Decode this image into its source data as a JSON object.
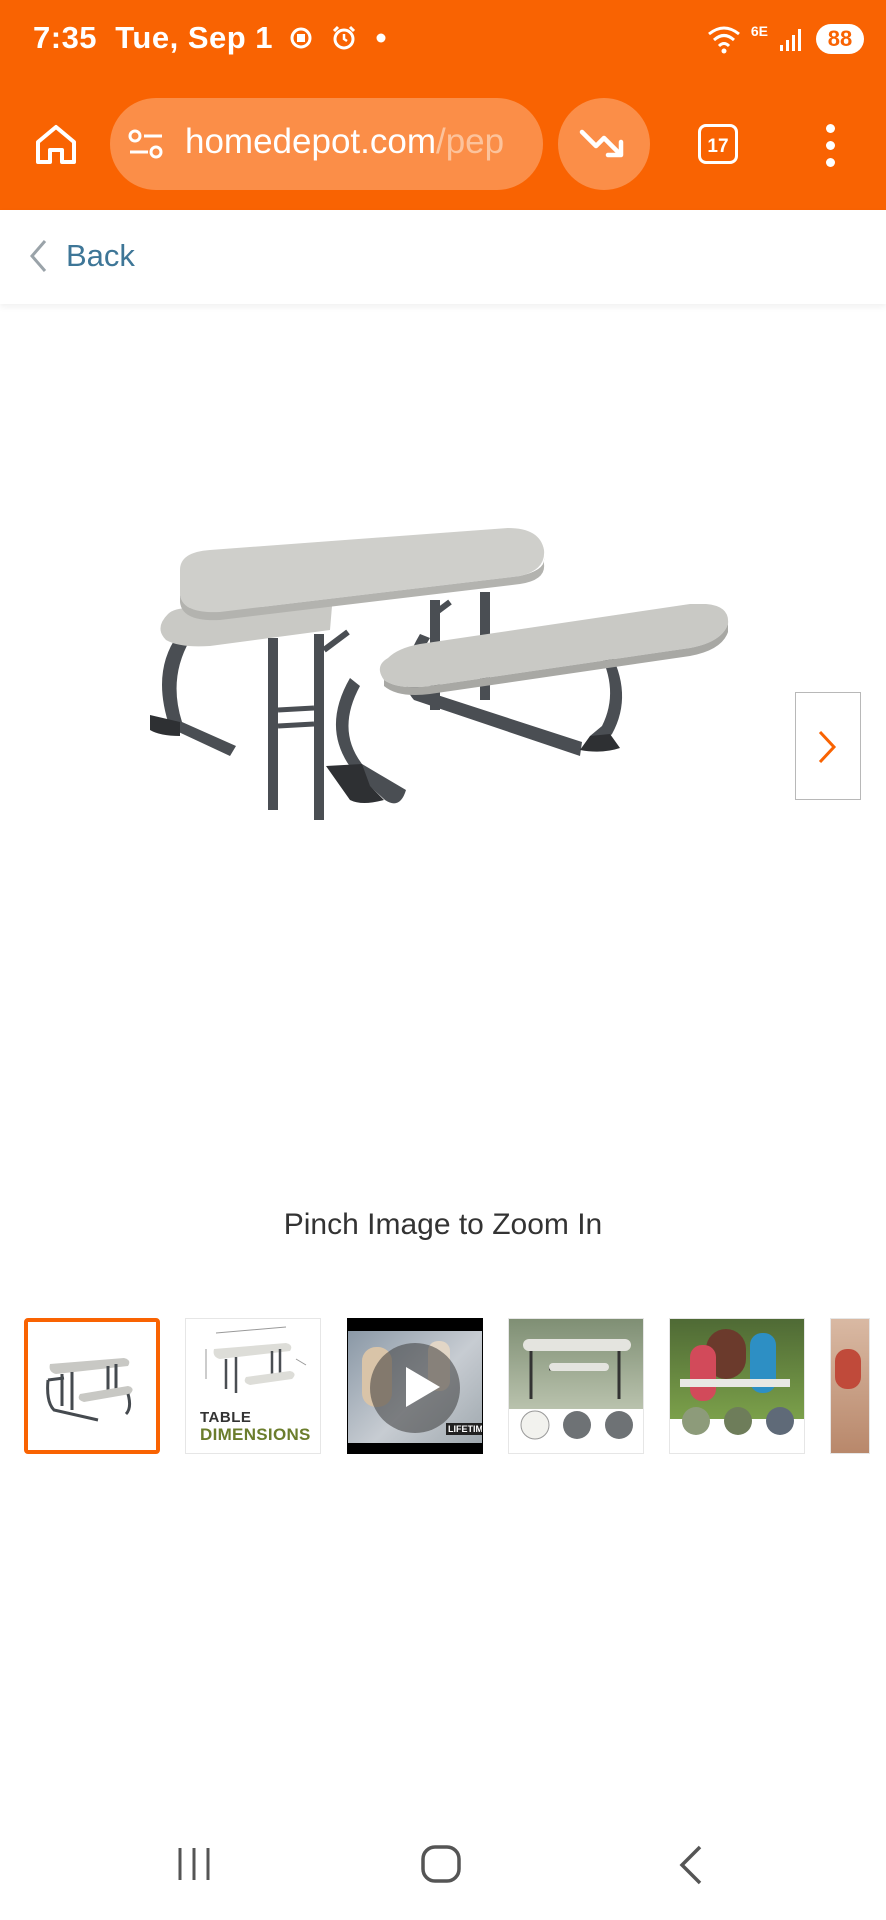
{
  "status_bar": {
    "time": "7:35",
    "date": "Tue, Sep 1",
    "network_label": "6E",
    "battery": "88"
  },
  "browser": {
    "url_host": "homedepot.com",
    "url_path": "/pep",
    "tab_count": "17"
  },
  "nav": {
    "back_label": "Back"
  },
  "gallery": {
    "zoom_hint": "Pinch Image to Zoom In",
    "thumbnails": [
      {
        "kind": "photo",
        "selected": true
      },
      {
        "kind": "dimensions",
        "caption_line1": "TABLE",
        "caption_line2": "DIMENSIONS"
      },
      {
        "kind": "video",
        "badge": "LIFETIME"
      },
      {
        "kind": "features"
      },
      {
        "kind": "lifestyle"
      },
      {
        "kind": "lifestyle"
      }
    ]
  },
  "colors": {
    "brand_orange": "#f96302",
    "link_blue": "#3e7697"
  }
}
